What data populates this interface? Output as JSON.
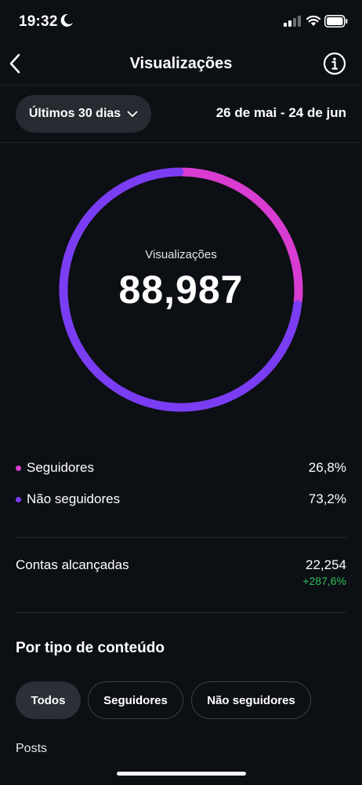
{
  "status_bar": {
    "time": "19:32"
  },
  "header": {
    "title": "Visualizações"
  },
  "period": {
    "selected": "Últimos 30 dias",
    "date_range": "26 de mai - 24 de jun"
  },
  "donut": {
    "label": "Visualizações",
    "value": "88,987"
  },
  "chart_data": {
    "type": "pie",
    "labels": [
      "Seguidores",
      "Não seguidores"
    ],
    "values": [
      26.8,
      73.2
    ],
    "colors": [
      "#d93cd0",
      "#7b3df4"
    ]
  },
  "legend": [
    {
      "label": "Seguidores",
      "value": "26,8%",
      "color": "#d93cd0"
    },
    {
      "label": "Não seguidores",
      "value": "73,2%",
      "color": "#7b3df4"
    }
  ],
  "reach": {
    "label": "Contas alcançadas",
    "value": "22,254",
    "change": "+287,6%"
  },
  "content_section": {
    "title": "Por tipo de conteúdo",
    "filters": [
      "Todos",
      "Seguidores",
      "Não seguidores"
    ],
    "active_filter": "Todos",
    "first_item": "Posts"
  },
  "icons": {
    "moon": "moon-icon",
    "signal": "cellular-signal-icon",
    "wifi": "wifi-icon",
    "battery": "battery-icon",
    "back": "chevron-left-icon",
    "info": "info-icon",
    "dropdown": "chevron-down-icon"
  }
}
